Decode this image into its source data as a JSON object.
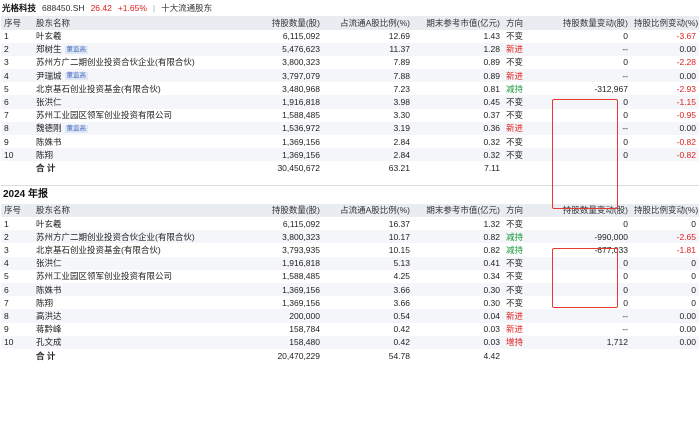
{
  "header": {
    "stock_name": "光格科技",
    "stock_code": "688450.SH",
    "price": "26.42",
    "change_pct": "+1.65%",
    "separator": "|",
    "crumb": "十大流通股东"
  },
  "columns": [
    "序号",
    "股东名称",
    "持股数量(股)",
    "占流通A股比例(%)",
    "期末参考市值(亿元)",
    "方向",
    "持股数量变动(股)",
    "持股比例变动(%)"
  ],
  "table1": {
    "rows": [
      {
        "idx": "1",
        "name": "叶玄羲",
        "tag": "",
        "shares": "6,115,092",
        "ratio": "12.69",
        "value": "1.43",
        "dir": "不变",
        "dirclass": "",
        "chg_shares": "0",
        "chg_ratio": "-3.67",
        "neg": true
      },
      {
        "idx": "2",
        "name": "郑树生",
        "tag": "董监高",
        "shares": "5,476,623",
        "ratio": "11.37",
        "value": "1.28",
        "dir": "新进",
        "dirclass": "dir-up",
        "chg_shares": "--",
        "chg_ratio": "0.00",
        "neg": false
      },
      {
        "idx": "3",
        "name": "苏州方广二期创业投资合伙企业(有限合伙)",
        "tag": "",
        "shares": "3,800,323",
        "ratio": "7.89",
        "value": "0.89",
        "dir": "不变",
        "dirclass": "",
        "chg_shares": "0",
        "chg_ratio": "-2.28",
        "neg": true
      },
      {
        "idx": "4",
        "name": "尹瑞城",
        "tag": "董监高",
        "shares": "3,797,079",
        "ratio": "7.88",
        "value": "0.89",
        "dir": "新进",
        "dirclass": "dir-up",
        "chg_shares": "--",
        "chg_ratio": "0.00",
        "neg": false
      },
      {
        "idx": "5",
        "name": "北京基石创业投资基金(有限合伙)",
        "tag": "",
        "shares": "3,480,968",
        "ratio": "7.23",
        "value": "0.81",
        "dir": "减持",
        "dirclass": "dir-down",
        "chg_shares": "-312,967",
        "chg_ratio": "-2.93",
        "neg": true
      },
      {
        "idx": "6",
        "name": "张洪仁",
        "tag": "",
        "shares": "1,916,818",
        "ratio": "3.98",
        "value": "0.45",
        "dir": "不变",
        "dirclass": "",
        "chg_shares": "0",
        "chg_ratio": "-1.15",
        "neg": true
      },
      {
        "idx": "7",
        "name": "苏州工业园区领军创业投资有限公司",
        "tag": "",
        "shares": "1,588,485",
        "ratio": "3.30",
        "value": "0.37",
        "dir": "不变",
        "dirclass": "",
        "chg_shares": "0",
        "chg_ratio": "-0.95",
        "neg": true
      },
      {
        "idx": "8",
        "name": "魏德刚",
        "tag": "董监高",
        "shares": "1,536,972",
        "ratio": "3.19",
        "value": "0.36",
        "dir": "新进",
        "dirclass": "dir-up",
        "chg_shares": "--",
        "chg_ratio": "0.00",
        "neg": false
      },
      {
        "idx": "9",
        "name": "陈姝书",
        "tag": "",
        "shares": "1,369,156",
        "ratio": "2.84",
        "value": "0.32",
        "dir": "不变",
        "dirclass": "",
        "chg_shares": "0",
        "chg_ratio": "-0.82",
        "neg": true
      },
      {
        "idx": "10",
        "name": "陈翔",
        "tag": "",
        "shares": "1,369,156",
        "ratio": "2.84",
        "value": "0.32",
        "dir": "不变",
        "dirclass": "",
        "chg_shares": "0",
        "chg_ratio": "-0.82",
        "neg": true
      }
    ],
    "total": {
      "label": "合 计",
      "shares": "30,450,672",
      "ratio": "63.21",
      "value": "7.11"
    }
  },
  "section2_title": "2024 年报",
  "table2": {
    "rows": [
      {
        "idx": "1",
        "name": "叶玄羲",
        "tag": "",
        "shares": "6,115,092",
        "ratio": "16.37",
        "value": "1.32",
        "dir": "不变",
        "dirclass": "",
        "chg_shares": "0",
        "chg_ratio": "0",
        "neg": false
      },
      {
        "idx": "2",
        "name": "苏州方广二期创业投资合伙企业(有限合伙)",
        "tag": "",
        "shares": "3,800,323",
        "ratio": "10.17",
        "value": "0.82",
        "dir": "减持",
        "dirclass": "dir-down",
        "chg_shares": "-990,000",
        "chg_ratio": "-2.65",
        "neg": true
      },
      {
        "idx": "3",
        "name": "北京基石创业投资基金(有限合伙)",
        "tag": "",
        "shares": "3,793,935",
        "ratio": "10.15",
        "value": "0.82",
        "dir": "减持",
        "dirclass": "dir-down",
        "chg_shares": "-677,033",
        "chg_ratio": "-1.81",
        "neg": true
      },
      {
        "idx": "4",
        "name": "张洪仁",
        "tag": "",
        "shares": "1,916,818",
        "ratio": "5.13",
        "value": "0.41",
        "dir": "不变",
        "dirclass": "",
        "chg_shares": "0",
        "chg_ratio": "0",
        "neg": false
      },
      {
        "idx": "5",
        "name": "苏州工业园区领军创业投资有限公司",
        "tag": "",
        "shares": "1,588,485",
        "ratio": "4.25",
        "value": "0.34",
        "dir": "不变",
        "dirclass": "",
        "chg_shares": "0",
        "chg_ratio": "0",
        "neg": false
      },
      {
        "idx": "6",
        "name": "陈姝书",
        "tag": "",
        "shares": "1,369,156",
        "ratio": "3.66",
        "value": "0.30",
        "dir": "不变",
        "dirclass": "",
        "chg_shares": "0",
        "chg_ratio": "0",
        "neg": false
      },
      {
        "idx": "7",
        "name": "陈翔",
        "tag": "",
        "shares": "1,369,156",
        "ratio": "3.66",
        "value": "0.30",
        "dir": "不变",
        "dirclass": "",
        "chg_shares": "0",
        "chg_ratio": "0",
        "neg": false
      },
      {
        "idx": "8",
        "name": "高洪达",
        "tag": "",
        "shares": "200,000",
        "ratio": "0.54",
        "value": "0.04",
        "dir": "新进",
        "dirclass": "dir-up",
        "chg_shares": "--",
        "chg_ratio": "0.00",
        "neg": false
      },
      {
        "idx": "9",
        "name": "蒋黔峰",
        "tag": "",
        "shares": "158,784",
        "ratio": "0.42",
        "value": "0.03",
        "dir": "新进",
        "dirclass": "dir-up",
        "chg_shares": "--",
        "chg_ratio": "0.00",
        "neg": false
      },
      {
        "idx": "10",
        "name": "孔文成",
        "tag": "",
        "shares": "158,480",
        "ratio": "0.42",
        "value": "0.03",
        "dir": "增持",
        "dirclass": "dir-up",
        "chg_shares": "1,712",
        "chg_ratio": "0.00",
        "neg": false
      }
    ],
    "total": {
      "label": "合 计",
      "shares": "20,470,229",
      "ratio": "54.78",
      "value": "4.42"
    }
  },
  "colors": {
    "up": "#e02020",
    "down": "#1a9a3a",
    "header_bg": "#e9edf2",
    "highlight_box": "#e43a30"
  }
}
